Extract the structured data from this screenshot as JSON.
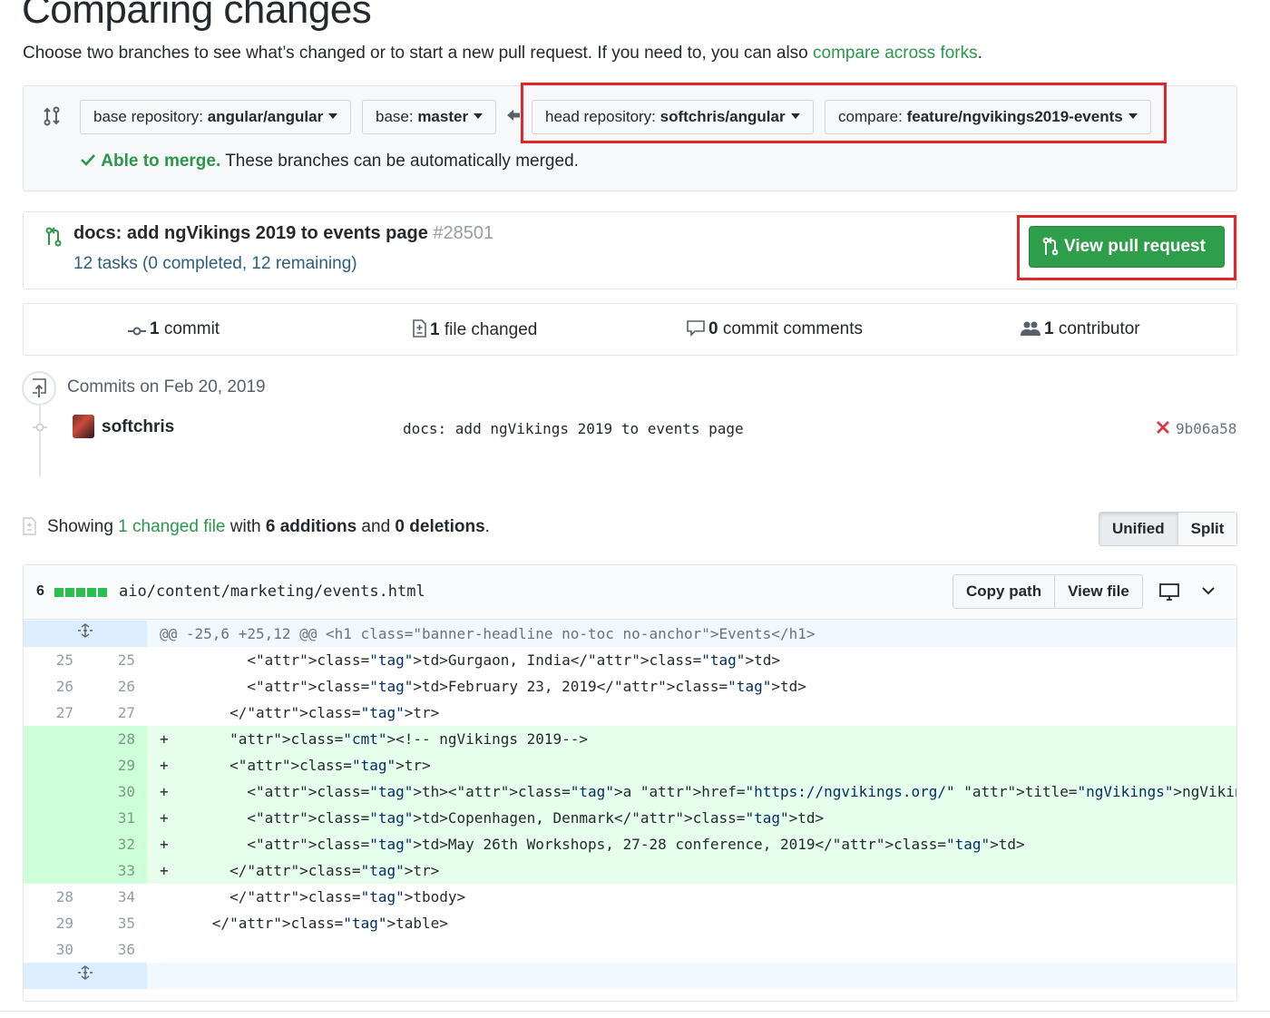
{
  "page": {
    "title": "Comparing changes",
    "subtitle_prefix": "Choose two branches to see what’s changed or to start a new pull request. If you need to, you can also ",
    "subtitle_link": "compare across forks",
    "subtitle_suffix": "."
  },
  "range": {
    "base_repo_label": "base repository: ",
    "base_repo_value": "angular/angular",
    "base_branch_label": "base: ",
    "base_branch_value": "master",
    "head_repo_label": "head repository: ",
    "head_repo_value": "softchris/angular",
    "compare_label": "compare: ",
    "compare_value": "feature/ngvikings2019-events",
    "merge_ok": "Able to merge.",
    "merge_text": " These branches can be automatically merged."
  },
  "pull_request": {
    "title": "docs: add ngVikings 2019 to events page ",
    "number": "#28501",
    "tasks": "12 tasks (0 completed, 12 remaining)",
    "button": "View pull request"
  },
  "stats": {
    "commits_num": "1",
    "commits_label": " commit",
    "files_num": "1",
    "files_label": " file changed",
    "comments_num": "0",
    "comments_label": " commit comments",
    "contributors_num": "1",
    "contributors_label": " contributor"
  },
  "commits": {
    "date": "Commits on Feb 20, 2019",
    "author": "softchris",
    "message": "docs: add ngVikings 2019 to events page",
    "sha": "9b06a58",
    "status": "failure"
  },
  "files_summary": {
    "prefix": "Showing ",
    "link": "1 changed file",
    "mid": " with ",
    "additions": "6 additions",
    "and": " and ",
    "deletions": "0 deletions",
    "end": "."
  },
  "diff_view": {
    "unified": "Unified",
    "split": "Split"
  },
  "file": {
    "count": "6",
    "path": "aio/content/marketing/events.html",
    "copy_path": "Copy path",
    "view_file": "View file"
  },
  "diff_lines": [
    {
      "type": "hunk",
      "old": "",
      "new": "",
      "text": "@@ -25,6 +25,12 @@ <h1 class=\"banner-headline no-toc no-anchor\">Events</h1>"
    },
    {
      "type": "ctx",
      "old": "25",
      "new": "25",
      "text": "          <td>Gurgaon, India</td>"
    },
    {
      "type": "ctx",
      "old": "26",
      "new": "26",
      "text": "          <td>February 23, 2019</td>"
    },
    {
      "type": "ctx",
      "old": "27",
      "new": "27",
      "text": "        </tr>"
    },
    {
      "type": "add",
      "old": "",
      "new": "28",
      "text": "+       <!-- ngVikings 2019-->"
    },
    {
      "type": "add",
      "old": "",
      "new": "29",
      "text": "+       <tr>"
    },
    {
      "type": "add",
      "old": "",
      "new": "30",
      "text": "+         <th><a href=\"https://ngvikings.org/\" title=\"ngVikings\">ngVikings</a></th>"
    },
    {
      "type": "add",
      "old": "",
      "new": "31",
      "text": "+         <td>Copenhagen, Denmark</td>"
    },
    {
      "type": "add",
      "old": "",
      "new": "32",
      "text": "+         <td>May 26th Workshops, 27-28 conference, 2019</td>"
    },
    {
      "type": "add",
      "old": "",
      "new": "33",
      "text": "+       </tr>"
    },
    {
      "type": "ctx",
      "old": "28",
      "new": "34",
      "text": "        </tbody>"
    },
    {
      "type": "ctx",
      "old": "29",
      "new": "35",
      "text": "      </table>"
    },
    {
      "type": "ctx",
      "old": "30",
      "new": "36",
      "text": ""
    },
    {
      "type": "hunk-end",
      "old": "",
      "new": "",
      "text": ""
    }
  ],
  "colors": {
    "accent_green": "#2c974b",
    "button_green": "#2f9e4a",
    "highlight_red": "#e0262b",
    "add_bg": "#e6ffed",
    "hunk_bg": "#f1f8ff"
  }
}
